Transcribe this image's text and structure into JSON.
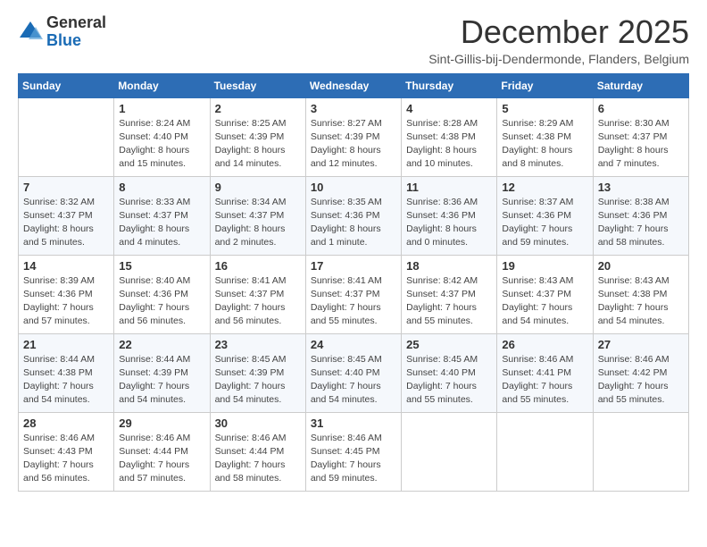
{
  "header": {
    "logo_general": "General",
    "logo_blue": "Blue",
    "month_title": "December 2025",
    "subtitle": "Sint-Gillis-bij-Dendermonde, Flanders, Belgium"
  },
  "days_of_week": [
    "Sunday",
    "Monday",
    "Tuesday",
    "Wednesday",
    "Thursday",
    "Friday",
    "Saturday"
  ],
  "weeks": [
    [
      {
        "day": null
      },
      {
        "day": "1",
        "sunrise": "Sunrise: 8:24 AM",
        "sunset": "Sunset: 4:40 PM",
        "daylight": "Daylight: 8 hours and 15 minutes."
      },
      {
        "day": "2",
        "sunrise": "Sunrise: 8:25 AM",
        "sunset": "Sunset: 4:39 PM",
        "daylight": "Daylight: 8 hours and 14 minutes."
      },
      {
        "day": "3",
        "sunrise": "Sunrise: 8:27 AM",
        "sunset": "Sunset: 4:39 PM",
        "daylight": "Daylight: 8 hours and 12 minutes."
      },
      {
        "day": "4",
        "sunrise": "Sunrise: 8:28 AM",
        "sunset": "Sunset: 4:38 PM",
        "daylight": "Daylight: 8 hours and 10 minutes."
      },
      {
        "day": "5",
        "sunrise": "Sunrise: 8:29 AM",
        "sunset": "Sunset: 4:38 PM",
        "daylight": "Daylight: 8 hours and 8 minutes."
      },
      {
        "day": "6",
        "sunrise": "Sunrise: 8:30 AM",
        "sunset": "Sunset: 4:37 PM",
        "daylight": "Daylight: 8 hours and 7 minutes."
      }
    ],
    [
      {
        "day": "7",
        "sunrise": "Sunrise: 8:32 AM",
        "sunset": "Sunset: 4:37 PM",
        "daylight": "Daylight: 8 hours and 5 minutes."
      },
      {
        "day": "8",
        "sunrise": "Sunrise: 8:33 AM",
        "sunset": "Sunset: 4:37 PM",
        "daylight": "Daylight: 8 hours and 4 minutes."
      },
      {
        "day": "9",
        "sunrise": "Sunrise: 8:34 AM",
        "sunset": "Sunset: 4:37 PM",
        "daylight": "Daylight: 8 hours and 2 minutes."
      },
      {
        "day": "10",
        "sunrise": "Sunrise: 8:35 AM",
        "sunset": "Sunset: 4:36 PM",
        "daylight": "Daylight: 8 hours and 1 minute."
      },
      {
        "day": "11",
        "sunrise": "Sunrise: 8:36 AM",
        "sunset": "Sunset: 4:36 PM",
        "daylight": "Daylight: 8 hours and 0 minutes."
      },
      {
        "day": "12",
        "sunrise": "Sunrise: 8:37 AM",
        "sunset": "Sunset: 4:36 PM",
        "daylight": "Daylight: 7 hours and 59 minutes."
      },
      {
        "day": "13",
        "sunrise": "Sunrise: 8:38 AM",
        "sunset": "Sunset: 4:36 PM",
        "daylight": "Daylight: 7 hours and 58 minutes."
      }
    ],
    [
      {
        "day": "14",
        "sunrise": "Sunrise: 8:39 AM",
        "sunset": "Sunset: 4:36 PM",
        "daylight": "Daylight: 7 hours and 57 minutes."
      },
      {
        "day": "15",
        "sunrise": "Sunrise: 8:40 AM",
        "sunset": "Sunset: 4:36 PM",
        "daylight": "Daylight: 7 hours and 56 minutes."
      },
      {
        "day": "16",
        "sunrise": "Sunrise: 8:41 AM",
        "sunset": "Sunset: 4:37 PM",
        "daylight": "Daylight: 7 hours and 56 minutes."
      },
      {
        "day": "17",
        "sunrise": "Sunrise: 8:41 AM",
        "sunset": "Sunset: 4:37 PM",
        "daylight": "Daylight: 7 hours and 55 minutes."
      },
      {
        "day": "18",
        "sunrise": "Sunrise: 8:42 AM",
        "sunset": "Sunset: 4:37 PM",
        "daylight": "Daylight: 7 hours and 55 minutes."
      },
      {
        "day": "19",
        "sunrise": "Sunrise: 8:43 AM",
        "sunset": "Sunset: 4:37 PM",
        "daylight": "Daylight: 7 hours and 54 minutes."
      },
      {
        "day": "20",
        "sunrise": "Sunrise: 8:43 AM",
        "sunset": "Sunset: 4:38 PM",
        "daylight": "Daylight: 7 hours and 54 minutes."
      }
    ],
    [
      {
        "day": "21",
        "sunrise": "Sunrise: 8:44 AM",
        "sunset": "Sunset: 4:38 PM",
        "daylight": "Daylight: 7 hours and 54 minutes."
      },
      {
        "day": "22",
        "sunrise": "Sunrise: 8:44 AM",
        "sunset": "Sunset: 4:39 PM",
        "daylight": "Daylight: 7 hours and 54 minutes."
      },
      {
        "day": "23",
        "sunrise": "Sunrise: 8:45 AM",
        "sunset": "Sunset: 4:39 PM",
        "daylight": "Daylight: 7 hours and 54 minutes."
      },
      {
        "day": "24",
        "sunrise": "Sunrise: 8:45 AM",
        "sunset": "Sunset: 4:40 PM",
        "daylight": "Daylight: 7 hours and 54 minutes."
      },
      {
        "day": "25",
        "sunrise": "Sunrise: 8:45 AM",
        "sunset": "Sunset: 4:40 PM",
        "daylight": "Daylight: 7 hours and 55 minutes."
      },
      {
        "day": "26",
        "sunrise": "Sunrise: 8:46 AM",
        "sunset": "Sunset: 4:41 PM",
        "daylight": "Daylight: 7 hours and 55 minutes."
      },
      {
        "day": "27",
        "sunrise": "Sunrise: 8:46 AM",
        "sunset": "Sunset: 4:42 PM",
        "daylight": "Daylight: 7 hours and 55 minutes."
      }
    ],
    [
      {
        "day": "28",
        "sunrise": "Sunrise: 8:46 AM",
        "sunset": "Sunset: 4:43 PM",
        "daylight": "Daylight: 7 hours and 56 minutes."
      },
      {
        "day": "29",
        "sunrise": "Sunrise: 8:46 AM",
        "sunset": "Sunset: 4:44 PM",
        "daylight": "Daylight: 7 hours and 57 minutes."
      },
      {
        "day": "30",
        "sunrise": "Sunrise: 8:46 AM",
        "sunset": "Sunset: 4:44 PM",
        "daylight": "Daylight: 7 hours and 58 minutes."
      },
      {
        "day": "31",
        "sunrise": "Sunrise: 8:46 AM",
        "sunset": "Sunset: 4:45 PM",
        "daylight": "Daylight: 7 hours and 59 minutes."
      },
      {
        "day": null
      },
      {
        "day": null
      },
      {
        "day": null
      }
    ]
  ]
}
